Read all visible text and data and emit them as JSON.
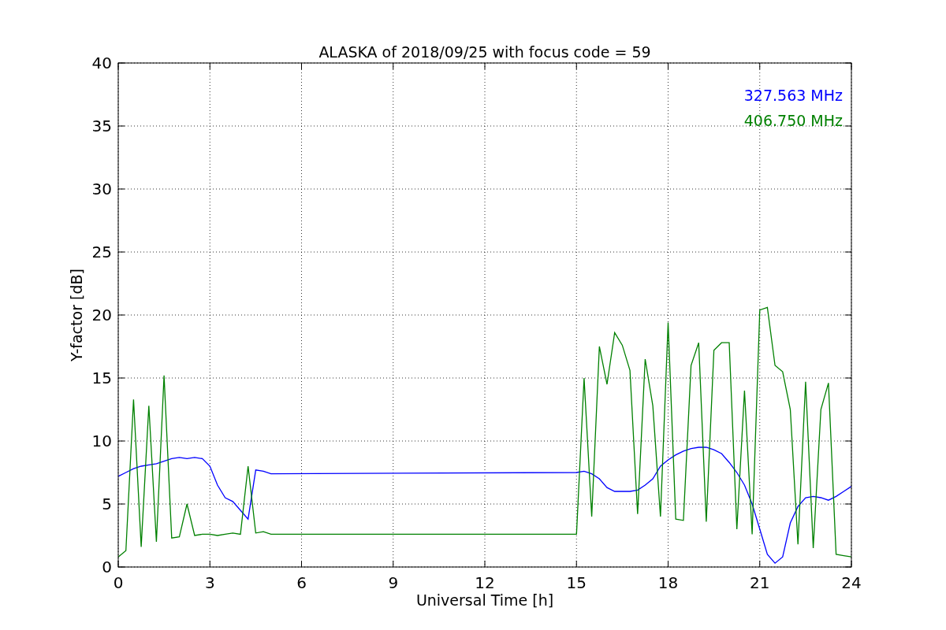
{
  "chart_data": {
    "type": "line",
    "title": "ALASKA of 2018/09/25 with focus code = 59",
    "xlabel": "Universal Time [h]",
    "ylabel": "Y-factor [dB]",
    "x": [
      0,
      0.25,
      0.5,
      0.75,
      1,
      1.25,
      1.5,
      1.75,
      2,
      2.25,
      2.5,
      2.75,
      3,
      3.25,
      3.5,
      3.75,
      4,
      4.25,
      4.5,
      4.75,
      5,
      15,
      15.25,
      15.5,
      15.75,
      16,
      16.25,
      16.5,
      16.75,
      17,
      17.25,
      17.5,
      17.75,
      18,
      18.25,
      18.5,
      18.75,
      19,
      19.25,
      19.5,
      19.75,
      20,
      20.25,
      20.5,
      20.75,
      21,
      21.25,
      21.5,
      21.75,
      22,
      22.25,
      22.5,
      22.75,
      23,
      23.25,
      23.5,
      23.75,
      24
    ],
    "series": [
      {
        "name": "327.563 MHz",
        "color": "#0000ff",
        "values": [
          7.2,
          7.5,
          7.8,
          8.0,
          8.1,
          8.2,
          8.4,
          8.6,
          8.7,
          8.6,
          8.7,
          8.6,
          8.0,
          6.5,
          5.5,
          5.2,
          4.5,
          3.8,
          7.7,
          7.6,
          7.4,
          7.5,
          7.6,
          7.4,
          7.0,
          6.3,
          6.0,
          6.0,
          6.0,
          6.1,
          6.5,
          7.0,
          8.0,
          8.5,
          8.9,
          9.2,
          9.4,
          9.5,
          9.5,
          9.3,
          9.0,
          8.3,
          7.5,
          6.5,
          5.0,
          3.0,
          1.0,
          0.3,
          0.8,
          3.5,
          4.8,
          5.5,
          5.6,
          5.5,
          5.3,
          5.6,
          6.0,
          6.4
        ]
      },
      {
        "name": "406.750 MHz",
        "color": "#008000",
        "values": [
          0.8,
          1.3,
          13.3,
          1.6,
          12.8,
          2.0,
          15.2,
          2.3,
          2.4,
          5.0,
          2.5,
          2.6,
          2.6,
          2.5,
          2.6,
          2.7,
          2.6,
          8.0,
          2.7,
          2.8,
          2.6,
          2.6,
          15.0,
          4.0,
          17.5,
          14.5,
          18.6,
          17.6,
          15.6,
          4.2,
          16.5,
          12.8,
          4.0,
          19.4,
          3.8,
          3.7,
          16.0,
          17.8,
          3.6,
          17.2,
          17.8,
          17.8,
          3.0,
          14.0,
          2.6,
          20.4,
          20.6,
          16.0,
          15.5,
          12.5,
          1.8,
          14.7,
          1.5,
          12.5,
          14.6,
          1.0,
          0.9,
          0.8
        ]
      }
    ],
    "grid": true,
    "xlim": [
      0,
      24
    ],
    "ylim": [
      0,
      40
    ],
    "xticks": [
      0,
      3,
      6,
      9,
      12,
      15,
      18,
      21,
      24
    ],
    "yticks": [
      0,
      5,
      10,
      15,
      20,
      25,
      30,
      35,
      40
    ]
  }
}
